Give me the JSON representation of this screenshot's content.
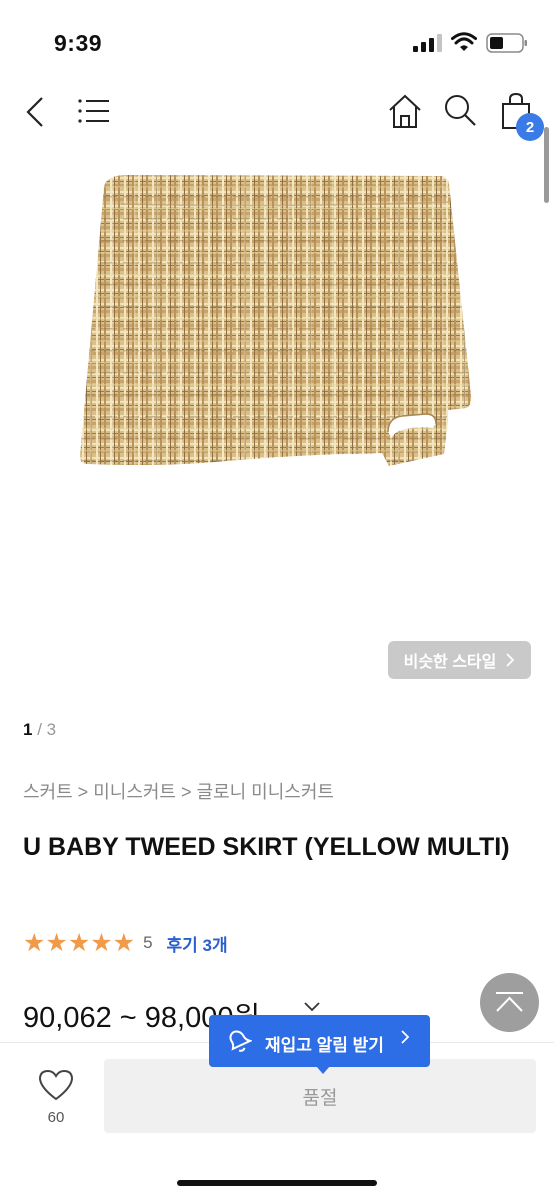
{
  "status_bar": {
    "time": "9:39"
  },
  "header": {
    "cart_count": "2"
  },
  "gallery": {
    "similar_label": "비슷한 스타일",
    "current": "1",
    "separator": "/",
    "total": "3"
  },
  "breadcrumb": "스커트 > 미니스커트 > 글로니 미니스커트",
  "product": {
    "title": "U BABY TWEED SKIRT (YELLOW MULTI)",
    "stars": "★★★★★",
    "rating_count": "5",
    "reviews_label": "후기 3개",
    "price": "90,062 ~ 98,000원"
  },
  "bottom": {
    "wish_count": "60",
    "soldout_label": "품절",
    "restock_label": "재입고 알림 받기"
  },
  "colors": {
    "accent": "#2d6de6",
    "star": "#f09a4a",
    "badge": "#3a7be8"
  }
}
